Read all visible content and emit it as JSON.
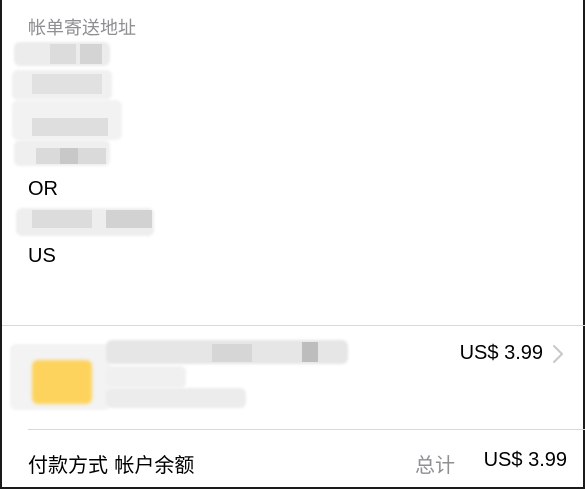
{
  "address": {
    "title": "帐单寄送地址",
    "state": "OR",
    "country": "US"
  },
  "item": {
    "price": "US$ 3.99",
    "thumbnail_color": "#fdd35d"
  },
  "footer": {
    "payment_label": "付款方式 帐户余额",
    "total_label": "总计",
    "total_value": "US$ 3.99"
  },
  "icons": {
    "chevron": "chevron-right-icon"
  }
}
